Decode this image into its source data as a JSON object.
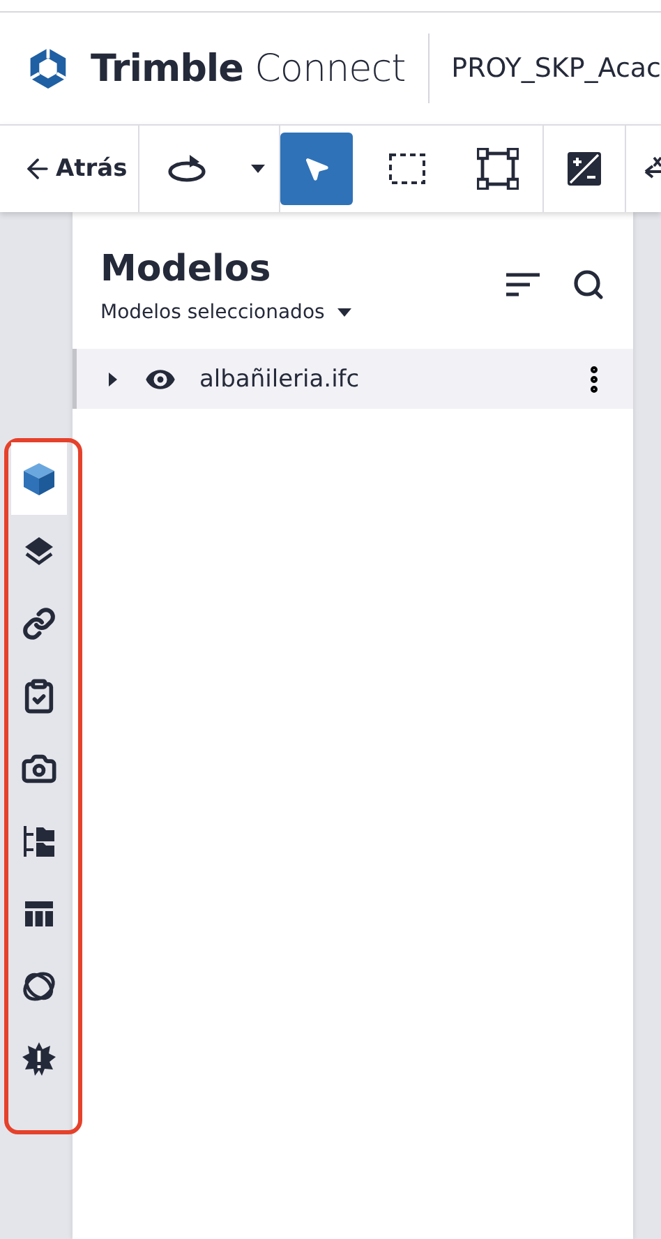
{
  "header": {
    "brand": "**Trimble** Connect",
    "project": "PROY_SKP_Acac"
  },
  "toolbar": {
    "back": "Atrás",
    "tools": [
      {
        "kind": "orbit",
        "selected": false
      },
      {
        "kind": "dropdown",
        "selected": false
      },
      {
        "kind": "select",
        "selected": true
      },
      {
        "kind": "area",
        "selected": false
      },
      {
        "kind": "fit",
        "selected": false
      },
      {
        "kind": "section",
        "selected": false
      },
      {
        "kind": "measure",
        "selected": false
      }
    ]
  },
  "sidebar": {
    "items": [
      {
        "kind": "models",
        "selected": true
      },
      {
        "kind": "layers",
        "selected": false
      },
      {
        "kind": "links",
        "selected": false
      },
      {
        "kind": "todo",
        "selected": false
      },
      {
        "kind": "views",
        "selected": false
      },
      {
        "kind": "tree",
        "selected": false
      },
      {
        "kind": "table",
        "selected": false
      },
      {
        "kind": "rings",
        "selected": false
      },
      {
        "kind": "clash",
        "selected": false
      }
    ]
  },
  "panel": {
    "title": "Modelos",
    "filter": "Modelos seleccionados",
    "models": [
      {
        "name": "albañileria.ifc",
        "visible": true,
        "expanded": false
      }
    ]
  }
}
